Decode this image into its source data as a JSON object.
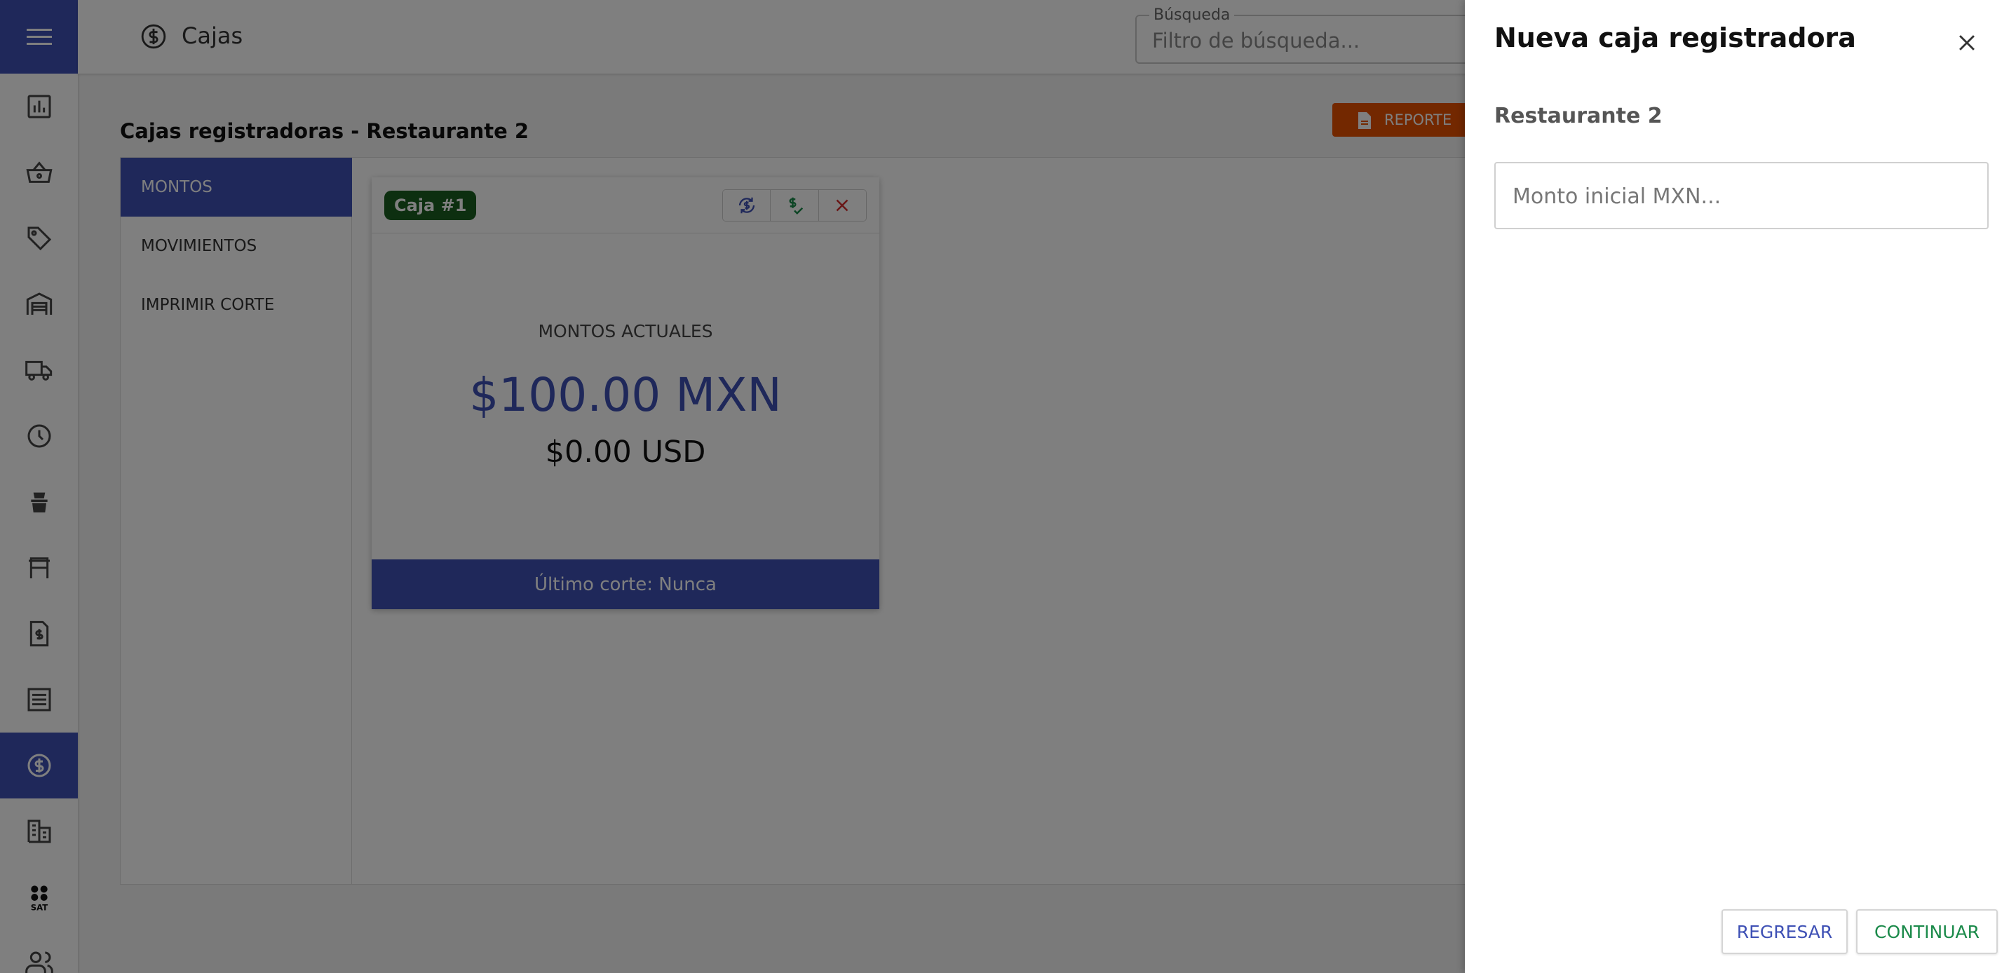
{
  "header": {
    "page_title": "Cajas",
    "search_legend": "Búsqueda",
    "search_placeholder": "Filtro de búsqueda..."
  },
  "sidebar": {
    "items": [
      {
        "icon": "bar-chart-icon"
      },
      {
        "icon": "shopping-basket-icon"
      },
      {
        "icon": "tag-icon"
      },
      {
        "icon": "warehouse-icon"
      },
      {
        "icon": "truck-icon"
      },
      {
        "icon": "clock-icon"
      },
      {
        "icon": "cook-icon"
      },
      {
        "icon": "table-icon"
      },
      {
        "icon": "invoice-icon"
      },
      {
        "icon": "list-icon"
      },
      {
        "icon": "dollar-icon",
        "active": true
      },
      {
        "icon": "building-icon"
      },
      {
        "icon": "sat-icon",
        "label": "SAT"
      },
      {
        "icon": "users-icon"
      }
    ]
  },
  "main": {
    "title": "Cajas registradoras - Restaurante 2",
    "report_button": "REPORTE",
    "tabs": [
      "MONTOS",
      "MOVIMIENTOS",
      "IMPRIMIR CORTE"
    ],
    "card": {
      "badge": "Caja #1",
      "label": "MONTOS ACTUALES",
      "amount_mxn": "$100.00 MXN",
      "amount_usd": "$0.00 USD",
      "footer": "Último corte: Nunca"
    }
  },
  "drawer": {
    "title": "Nueva caja registradora",
    "subtitle": "Restaurante 2",
    "amount_placeholder": "Monto inicial MXN...",
    "back_button": "REGRESAR",
    "continue_button": "CONTINUAR"
  },
  "colors": {
    "primary": "#3f51b5",
    "accent_orange": "#e65100",
    "success": "#1b8a4a",
    "badge_green": "#1b5e20",
    "danger": "#d32f2f"
  }
}
